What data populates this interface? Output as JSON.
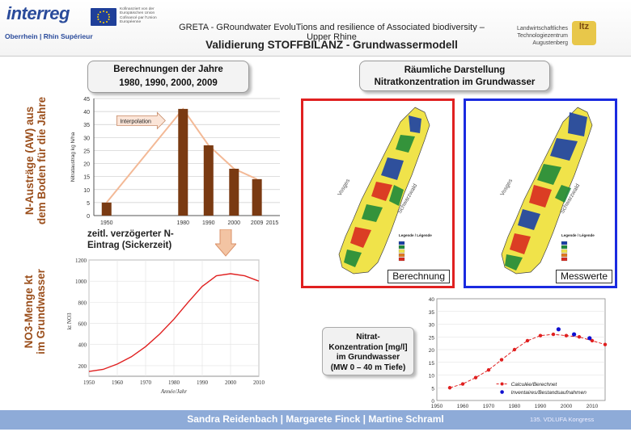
{
  "header": {
    "logo_text": "interreg",
    "logo_subtitle": "Oberrhein | Rhin Supérieur",
    "eu_text": "Kofinanziert von der Europäischen Union Cofinancé par l'Union Européenne",
    "title": "GRETA - GRoundwater EvoluTions and resilience of Associated biodiversity – Upper Rhine",
    "subtitle": "Validierung  STOFFBILANZ - Grundwassermodell",
    "ltz_line1": "Landwirtschaftliches",
    "ltz_line2": "Technologiezentrum",
    "ltz_line3": "Augustenberg",
    "ltz_logo": "ltz"
  },
  "left": {
    "calc_title_1": "Berechnungen der Jahre",
    "calc_title_2": "1980, 1990, 2000, 2009",
    "side_label_1": "N-Austräge (AW) aus dem Boden für die Jahre",
    "side_label_2": "NO3-Menge kt im Grundwasser",
    "interpolation_label": "Interpolation",
    "delay_label_1": "zeitl. verzögerter N-",
    "delay_label_2": "Eintrag (Sickerzeit)"
  },
  "right": {
    "spatial_title_1": "Räumliche Darstellung",
    "spatial_title_2": "Nitratkonzentration im Grundwasser",
    "map1_caption": "Berechnung",
    "map2_caption": "Messwerte",
    "map_label_vosges": "Vosges",
    "map_label_schwarzwald": "Schwarzwald",
    "legend_title": "Legende / Légende",
    "nitrate_box_1": "Nitrat-",
    "nitrate_box_2": "Konzentration [mg/l]",
    "nitrate_box_3": "im Grundwasser",
    "nitrate_box_4": "(MW 0 – 40 m Tiefe)"
  },
  "footer": {
    "names": "Sandra Reidenbach | Margarete Finck | Martine Schraml",
    "event": "135. VDLUFA Kongress"
  },
  "colors": {
    "bar": "#7a3a12",
    "interp": "#f3b996",
    "red": "#e02020",
    "blue": "#1010d0",
    "map1_border": "#e02020",
    "map2_border": "#1a2ae0"
  },
  "chart_data": [
    {
      "type": "bar",
      "x": [
        1950,
        1980,
        1990,
        2000,
        2009
      ],
      "values": [
        5,
        41,
        27,
        18,
        14
      ],
      "x_ticks": [
        1950,
        1980,
        1990,
        2000,
        2009,
        2015
      ],
      "ylabel": "Nitrataustrag kg N/ha",
      "ylim": [
        0,
        45
      ],
      "y_ticks": [
        0,
        5,
        10,
        15,
        20,
        25,
        30,
        35,
        40,
        45
      ],
      "annotation": "Interpolation"
    },
    {
      "type": "line",
      "x": [
        1950,
        1955,
        1960,
        1965,
        1970,
        1975,
        1980,
        1985,
        1990,
        1995,
        2000,
        2005,
        2010
      ],
      "y": [
        145,
        165,
        215,
        285,
        380,
        500,
        640,
        800,
        950,
        1050,
        1070,
        1050,
        1000
      ],
      "xlabel": "Année/Jahr",
      "ylabel": "kt NO3",
      "xlim": [
        1950,
        2010
      ],
      "ylim": [
        100,
        1200
      ],
      "x_ticks": [
        1950,
        1960,
        1970,
        1980,
        1990,
        2000,
        2010
      ],
      "y_ticks": [
        200,
        400,
        600,
        800,
        1000,
        1200
      ]
    },
    {
      "type": "line",
      "xlim": [
        1950,
        2015
      ],
      "ylim": [
        0,
        40
      ],
      "x_ticks": [
        1950,
        1960,
        1970,
        1980,
        1990,
        2000,
        2010
      ],
      "y_ticks": [
        0,
        5,
        10,
        15,
        20,
        25,
        30,
        35,
        40
      ],
      "series": [
        {
          "name": "Calculée/Berechnet",
          "x": [
            1955,
            1960,
            1965,
            1970,
            1975,
            1980,
            1985,
            1990,
            1995,
            2000,
            2005,
            2010,
            2015
          ],
          "y": [
            5,
            6.5,
            9,
            12,
            16,
            20,
            23.5,
            25.5,
            26,
            25.5,
            25,
            23.5,
            22
          ]
        },
        {
          "name": "Inventaires/Bestandsaufnahmen",
          "x": [
            1997,
            2003,
            2009
          ],
          "y": [
            28,
            26,
            24.5
          ]
        }
      ]
    }
  ]
}
